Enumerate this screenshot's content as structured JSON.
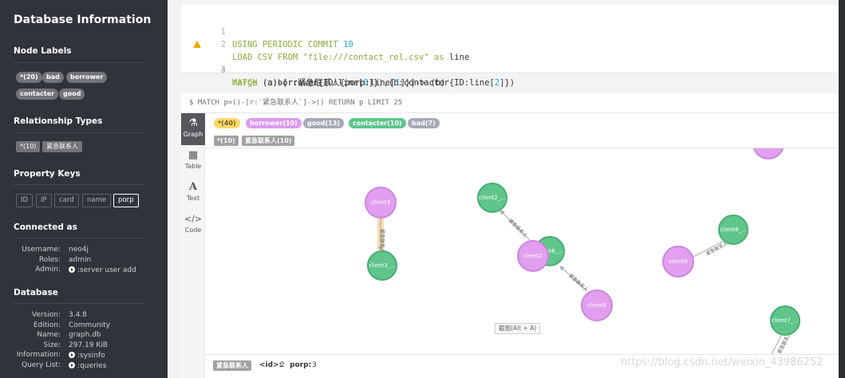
{
  "sidebar": {
    "title": "Database Information",
    "node_labels_heading": "Node Labels",
    "node_labels": [
      "*(20)",
      "bad",
      "borrower",
      "contacter",
      "good"
    ],
    "rel_types_heading": "Relationship Types",
    "rel_types": [
      "*(10)",
      "紧急联系人"
    ],
    "prop_keys_heading": "Property Keys",
    "prop_keys": [
      "ID",
      "IP",
      "card",
      "name",
      "porp"
    ],
    "connected_heading": "Connected as",
    "connected": {
      "username_label": "Username:",
      "username": "neo4j",
      "roles_label": "Roles:",
      "roles": "admin",
      "admin_label": "Admin:",
      "admin": ":server user add"
    },
    "database_heading": "Database",
    "database": {
      "version_label": "Version:",
      "version": "3.4.8",
      "edition_label": "Edition:",
      "edition": "Community",
      "name_label": "Name:",
      "name": "graph.db",
      "size_label": "Size:",
      "size": "297.19 KiB",
      "information_label": "Information:",
      "information": ":sysinfo",
      "querylist_label": "Query List:",
      "querylist": ":queries"
    }
  },
  "editor": {
    "line_numbers": [
      "1",
      "2",
      "3",
      "4"
    ],
    "line1": {
      "kw1": "USING PERIODIC COMMIT",
      "num": "10"
    },
    "line2": {
      "kw1": "LOAD CSV FROM",
      "str": "\"file:///contact_rel.csv\"",
      "kw2": "as",
      "plain": "line"
    },
    "line3": {
      "kw1": "MATCH",
      "p1": "(a:borrower{ID:line[",
      "n1": "0",
      "p2": "]}),(b:contacter{ID:line[",
      "n2": "2",
      "p3": "]})"
    },
    "line4": {
      "kw1": "merge",
      "p1": "(a)-[r:紧急联系人{porp:line[",
      "n1": "1",
      "p2": "]}]-> (b)"
    }
  },
  "result": {
    "query": "$ MATCH p=()-[r:`紧急联系人`]->() RETURN p LIMIT 25",
    "tabs": [
      "Graph",
      "Table",
      "Text",
      "Code"
    ],
    "node_legend": [
      {
        "label": "*(40)",
        "color": "#ffd86e",
        "text_color": "#6a5a1a"
      },
      {
        "label": "borrower(10)",
        "color": "#de9bf0"
      },
      {
        "label": "good(13)",
        "color": "#a5abb6"
      },
      {
        "label": "contacter(10)",
        "color": "#5fc58b"
      },
      {
        "label": "bad(7)",
        "color": "#a5abb6"
      }
    ],
    "rel_legend": [
      "*(10)",
      "紧急联系人(10)"
    ],
    "nodes": {
      "client3": "client3",
      "client3_g": "client3_...",
      "client2_g": "client2_...",
      "client6_g": "client6_...",
      "client2": "client2",
      "client6": "client6",
      "client8": "client8",
      "client8_g": "client8_...",
      "client7_g": "client7_..."
    },
    "edge_label": "紧急联系人",
    "tooltip": "截图(Alt + A)",
    "status": {
      "type": "紧急联系人",
      "id_label": "<id>:",
      "id": "2",
      "porp_label": "porp:",
      "porp": "3"
    }
  },
  "watermark": "https://blog.csdn.net/weixin_43986252"
}
